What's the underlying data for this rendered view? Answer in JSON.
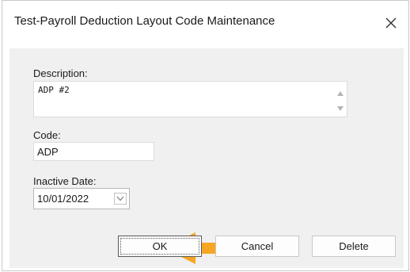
{
  "window": {
    "title": "Test-Payroll Deduction Layout Code Maintenance",
    "close_icon": "close-icon"
  },
  "form": {
    "description_label": "Description:",
    "description_value": "ADP #2",
    "code_label": "Code:",
    "code_value": "ADP",
    "inactive_label": "Inactive Date:",
    "inactive_value": "10/01/2022"
  },
  "annotation": {
    "arrow_color": "#f5a623",
    "arrow_direction": "left"
  },
  "buttons": {
    "ok_label": "OK",
    "cancel_label": "Cancel",
    "delete_label": "Delete"
  }
}
